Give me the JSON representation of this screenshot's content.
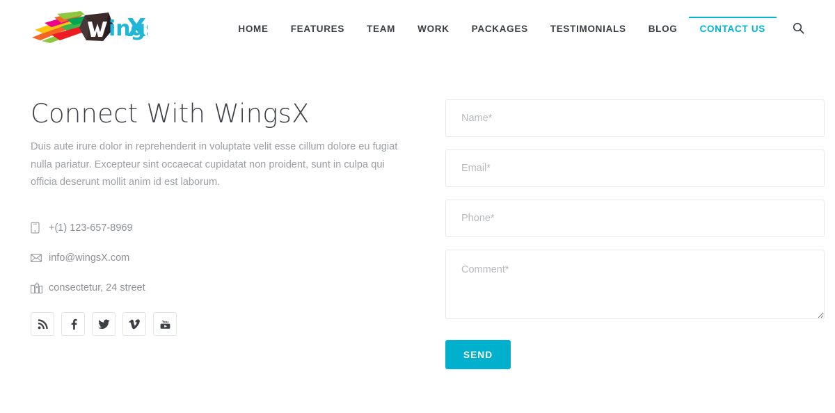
{
  "header": {
    "logo": {
      "name": "wingsx-logo",
      "text_dark": "W",
      "text_mid": "ings",
      "text_accent": "X",
      "accent_color": "#1fb6d8"
    },
    "nav": [
      {
        "label": "HOME",
        "active": false,
        "name": "nav-home"
      },
      {
        "label": "FEATURES",
        "active": false,
        "name": "nav-features"
      },
      {
        "label": "TEAM",
        "active": false,
        "name": "nav-team"
      },
      {
        "label": "WORK",
        "active": false,
        "name": "nav-work"
      },
      {
        "label": "PACKAGES",
        "active": false,
        "name": "nav-packages"
      },
      {
        "label": "TESTIMONIALS",
        "active": false,
        "name": "nav-testimonials"
      },
      {
        "label": "BLOG",
        "active": false,
        "name": "nav-blog"
      },
      {
        "label": "CONTACT US",
        "active": true,
        "name": "nav-contact-us"
      }
    ],
    "search_icon": "search-icon",
    "active_color": "#00b3d1"
  },
  "main": {
    "title": "Connect With WingsX",
    "intro": "Duis aute irure dolor in reprehenderit in voluptate velit esse cillum dolore eu fugiat nulla pariatur. Excepteur sint occaecat cupidatat non proident, sunt in culpa qui officia deserunt mollit anim id est laborum.",
    "contact_items": [
      {
        "icon": "mobile-phone-icon",
        "value": "+(1) 123-657-8969",
        "name": "contact-phone"
      },
      {
        "icon": "envelope-icon",
        "value": "info@wingsX.com",
        "name": "contact-email"
      },
      {
        "icon": "building-icon",
        "value": "consectetur, 24 street",
        "name": "contact-address"
      }
    ],
    "social_links": [
      {
        "icon": "rss-icon",
        "name": "social-rss"
      },
      {
        "icon": "facebook-icon",
        "name": "social-facebook"
      },
      {
        "icon": "twitter-icon",
        "name": "social-twitter"
      },
      {
        "icon": "vimeo-icon",
        "name": "social-vimeo"
      },
      {
        "icon": "youtube-icon",
        "name": "social-youtube"
      }
    ]
  },
  "form": {
    "name_value": "",
    "name_placeholder": "Name*",
    "email_value": "",
    "email_placeholder": "Email*",
    "phone_value": "",
    "phone_placeholder": "Phone*",
    "comment_value": "",
    "comment_placeholder": "Comment*",
    "submit_label": "SEND",
    "submit_color": "#00b0cc"
  }
}
